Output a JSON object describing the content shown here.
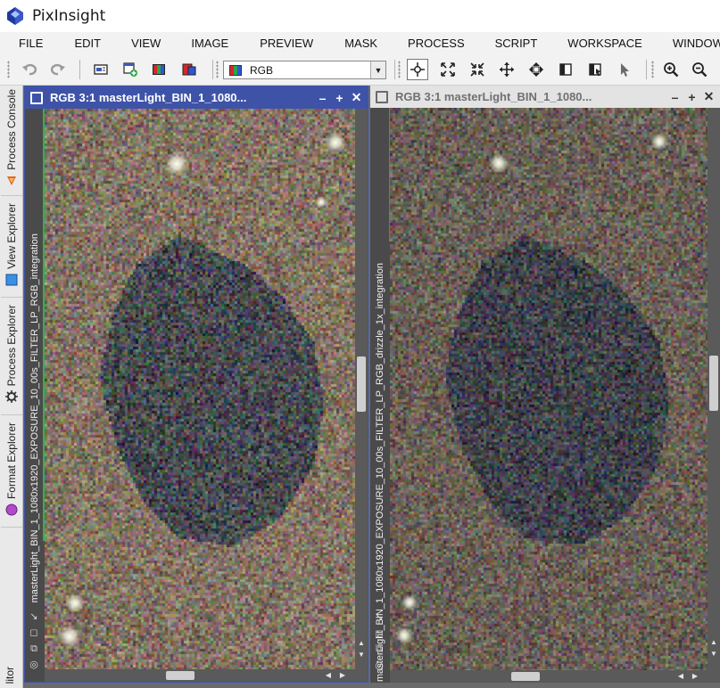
{
  "app": {
    "title": "PixInsight"
  },
  "menu": [
    "FILE",
    "EDIT",
    "VIEW",
    "IMAGE",
    "PREVIEW",
    "MASK",
    "PROCESS",
    "SCRIPT",
    "WORKSPACE",
    "WINDOW"
  ],
  "toolbar": {
    "view_selector": {
      "value": "RGB"
    },
    "icons": [
      "undo-icon",
      "redo-icon",
      "view-explorer-icon",
      "new-preview-icon",
      "rgb-channels-icon",
      "mask-icon",
      "readout-mode-icon",
      "zoom-fit-icon",
      "zoom-1-1-icon",
      "pan-mode-icon",
      "center-icon",
      "preview-mode-icon",
      "dynamic-preview-icon",
      "pointer-icon",
      "zoom-in-icon",
      "zoom-out-icon"
    ]
  },
  "side_panel": {
    "tabs": [
      {
        "label": "Process Console",
        "icon": "console-icon"
      },
      {
        "label": "View Explorer",
        "icon": "view-explorer-tab-icon"
      },
      {
        "label": "Process Explorer",
        "icon": "gear-icon"
      },
      {
        "label": "Format Explorer",
        "icon": "format-icon"
      }
    ],
    "bottom_tab": "litor"
  },
  "windows": [
    {
      "title": "RGB 3:1 masterLight_BIN_1_1080...",
      "identifier": "masterLight_BIN_1_1080x1920_EXPOSURE_10_00s_FILTER_LP_RGB_integration",
      "active": true
    },
    {
      "title": "RGB 3:1 masterLight_BIN_1_1080...",
      "identifier": "masterLight_BIN_1_1080x1920_EXPOSURE_10_00s_FILTER_LP_RGB_drizzle_1x_integration",
      "active": false
    }
  ],
  "window_controls": {
    "minimize": "–",
    "maximize": "+",
    "close": "✕"
  },
  "colors": {
    "active_title": "#3e53a8",
    "inactive_title": "#e3e3e3",
    "id_accent": "#2db34a"
  }
}
